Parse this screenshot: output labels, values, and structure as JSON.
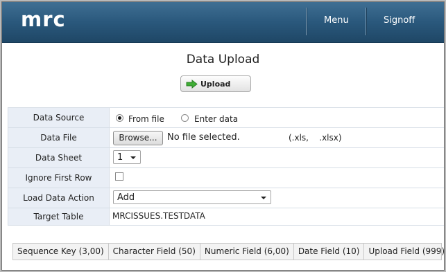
{
  "header": {
    "logo": "mrc",
    "nav": {
      "menu": "Menu",
      "signoff": "Signoff"
    }
  },
  "page": {
    "title": "Data Upload",
    "upload_button": "Upload"
  },
  "form": {
    "data_source": {
      "label": "Data Source",
      "options": [
        "From file",
        "Enter data"
      ],
      "selected": "From file"
    },
    "data_file": {
      "label": "Data File",
      "browse_button": "Browse...",
      "status": "No file selected.",
      "extensions": "(.xls,    .xlsx)"
    },
    "data_sheet": {
      "label": "Data Sheet",
      "value": "1"
    },
    "ignore_first_row": {
      "label": "Ignore First Row",
      "checked": false
    },
    "load_data_action": {
      "label": "Load Data Action",
      "value": "Add"
    },
    "target_table": {
      "label": "Target Table",
      "value": "MRCISSUES.TESTDATA"
    }
  },
  "fields": [
    "Sequence Key (3,00)",
    "Character Field (50)",
    "Numeric Field (6,00)",
    "Date Field (10)",
    "Upload Field (999)"
  ],
  "colors": {
    "header_top": "#3f6f93",
    "header_bottom": "#1f4766",
    "label_bg": "#e9eef6",
    "upload_arrow": "#3fae35"
  }
}
